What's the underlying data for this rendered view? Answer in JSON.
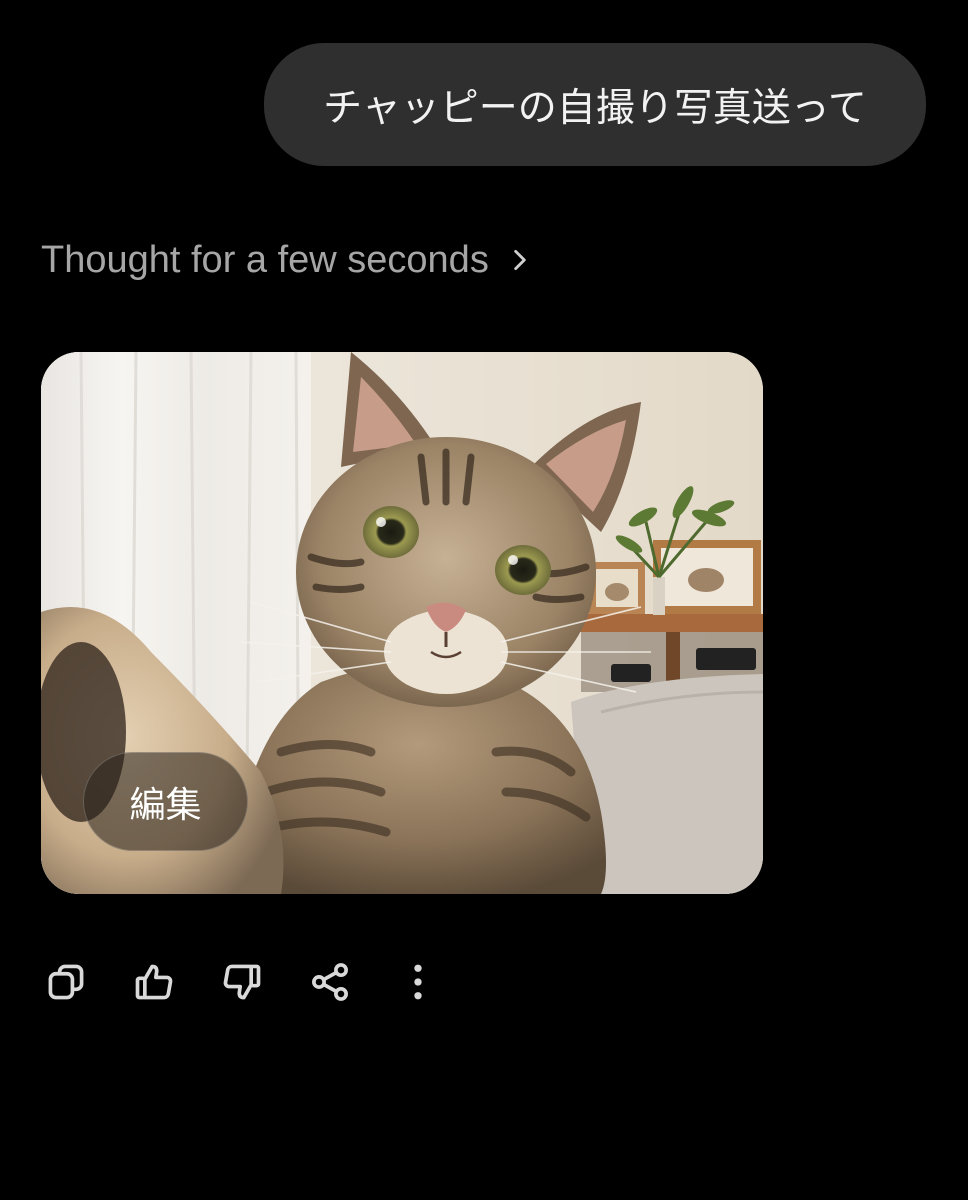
{
  "user_message": {
    "text": "チャッピーの自撮り写真送って"
  },
  "thought": {
    "label": "Thought for a few seconds",
    "icon": "chevron-right-icon"
  },
  "generated_image": {
    "edit_label": "編集"
  },
  "action_bar": {
    "icons": [
      "copy-icon",
      "thumbs-up-icon",
      "thumbs-down-icon",
      "share-icon",
      "more-vertical-icon"
    ]
  },
  "colors": {
    "background": "#000000",
    "user_bubble": "#2f2f2f",
    "thought_text": "#a6a6a6",
    "icon": "#d9d9d9"
  }
}
